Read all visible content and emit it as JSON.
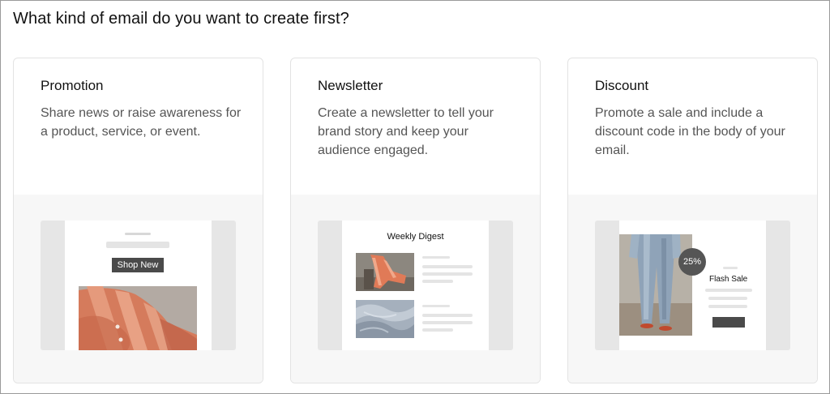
{
  "heading": "What kind of email do you want to create first?",
  "cards": [
    {
      "title": "Promotion",
      "description": "Share news or raise awareness for a product, service, or event.",
      "preview": {
        "button_label": "Shop New"
      }
    },
    {
      "title": "Newsletter",
      "description": "Create a newsletter to tell your brand story and keep your audience engaged.",
      "preview": {
        "title": "Weekly Digest"
      }
    },
    {
      "title": "Discount",
      "description": "Promote a sale and include a discount code in the body of your email.",
      "preview": {
        "badge": "25%",
        "title": "Flash Sale"
      }
    }
  ],
  "colors": {
    "border": "#e3e3e3",
    "preview_bg": "#f7f7f7",
    "dark_button": "#4a4a4a",
    "placeholder": "#e4e4e4"
  }
}
